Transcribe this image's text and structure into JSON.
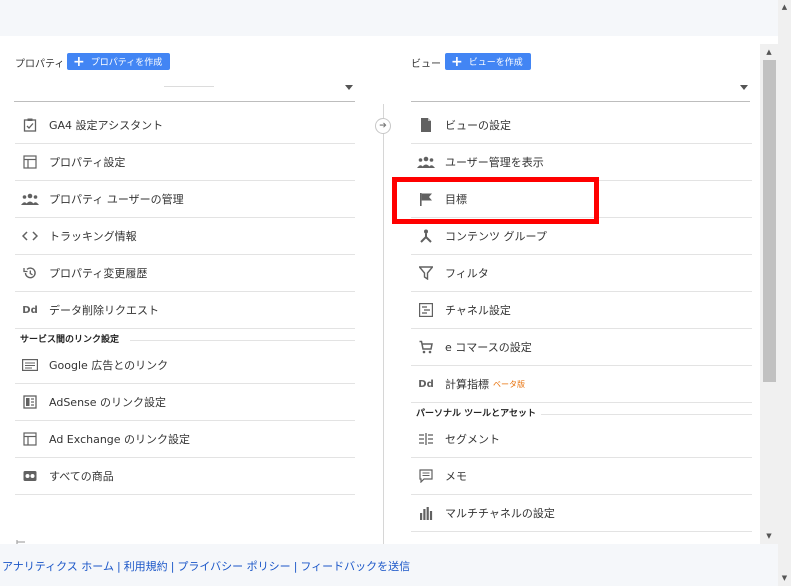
{
  "property": {
    "label": "プロパティ",
    "create_label": "プロパティを作成",
    "items": [
      {
        "label": "GA4 設定アシスタント",
        "icon": "checklist-icon"
      },
      {
        "label": "プロパティ設定",
        "icon": "property-settings-icon"
      },
      {
        "label": "プロパティ ユーザーの管理",
        "icon": "users-icon"
      },
      {
        "label": "トラッキング情報",
        "icon": "code-icon"
      },
      {
        "label": "プロパティ変更履歴",
        "icon": "history-icon"
      },
      {
        "label": "データ削除リクエスト",
        "icon": "dd-icon"
      }
    ],
    "section_title": "サービス間のリンク設定",
    "link_items": [
      {
        "label": "Google 広告とのリンク",
        "icon": "google-ads-icon"
      },
      {
        "label": "AdSense のリンク設定",
        "icon": "adsense-icon"
      },
      {
        "label": "Ad Exchange のリンク設定",
        "icon": "ad-exchange-icon"
      },
      {
        "label": "すべての商品",
        "icon": "all-products-icon"
      }
    ]
  },
  "view": {
    "label": "ビュー",
    "create_label": "ビューを作成",
    "items": [
      {
        "label": "ビューの設定",
        "icon": "document-icon"
      },
      {
        "label": "ユーザー管理を表示",
        "icon": "users-icon"
      },
      {
        "label": "目標",
        "icon": "flag-icon"
      },
      {
        "label": "コンテンツ グループ",
        "icon": "content-group-icon"
      },
      {
        "label": "フィルタ",
        "icon": "filter-icon"
      },
      {
        "label": "チャネル設定",
        "icon": "channel-icon"
      },
      {
        "label": "e コマースの設定",
        "icon": "cart-icon"
      },
      {
        "label": "計算指標",
        "icon": "dd-icon",
        "badge": "ベータ版"
      }
    ],
    "section_title": "パーソナル ツールとアセット",
    "personal_items": [
      {
        "label": "セグメント",
        "icon": "segment-icon"
      },
      {
        "label": "メモ",
        "icon": "comment-icon"
      },
      {
        "label": "マルチチャネルの設定",
        "icon": "bar-chart-icon"
      }
    ]
  },
  "footer": {
    "links": [
      "アナリティクス ホーム",
      "利用規約",
      "プライバシー ポリシー",
      "フィードバックを送信"
    ]
  },
  "colors": {
    "accent": "#4285f4",
    "highlight": "#ff0000",
    "link": "#1a56c8"
  }
}
